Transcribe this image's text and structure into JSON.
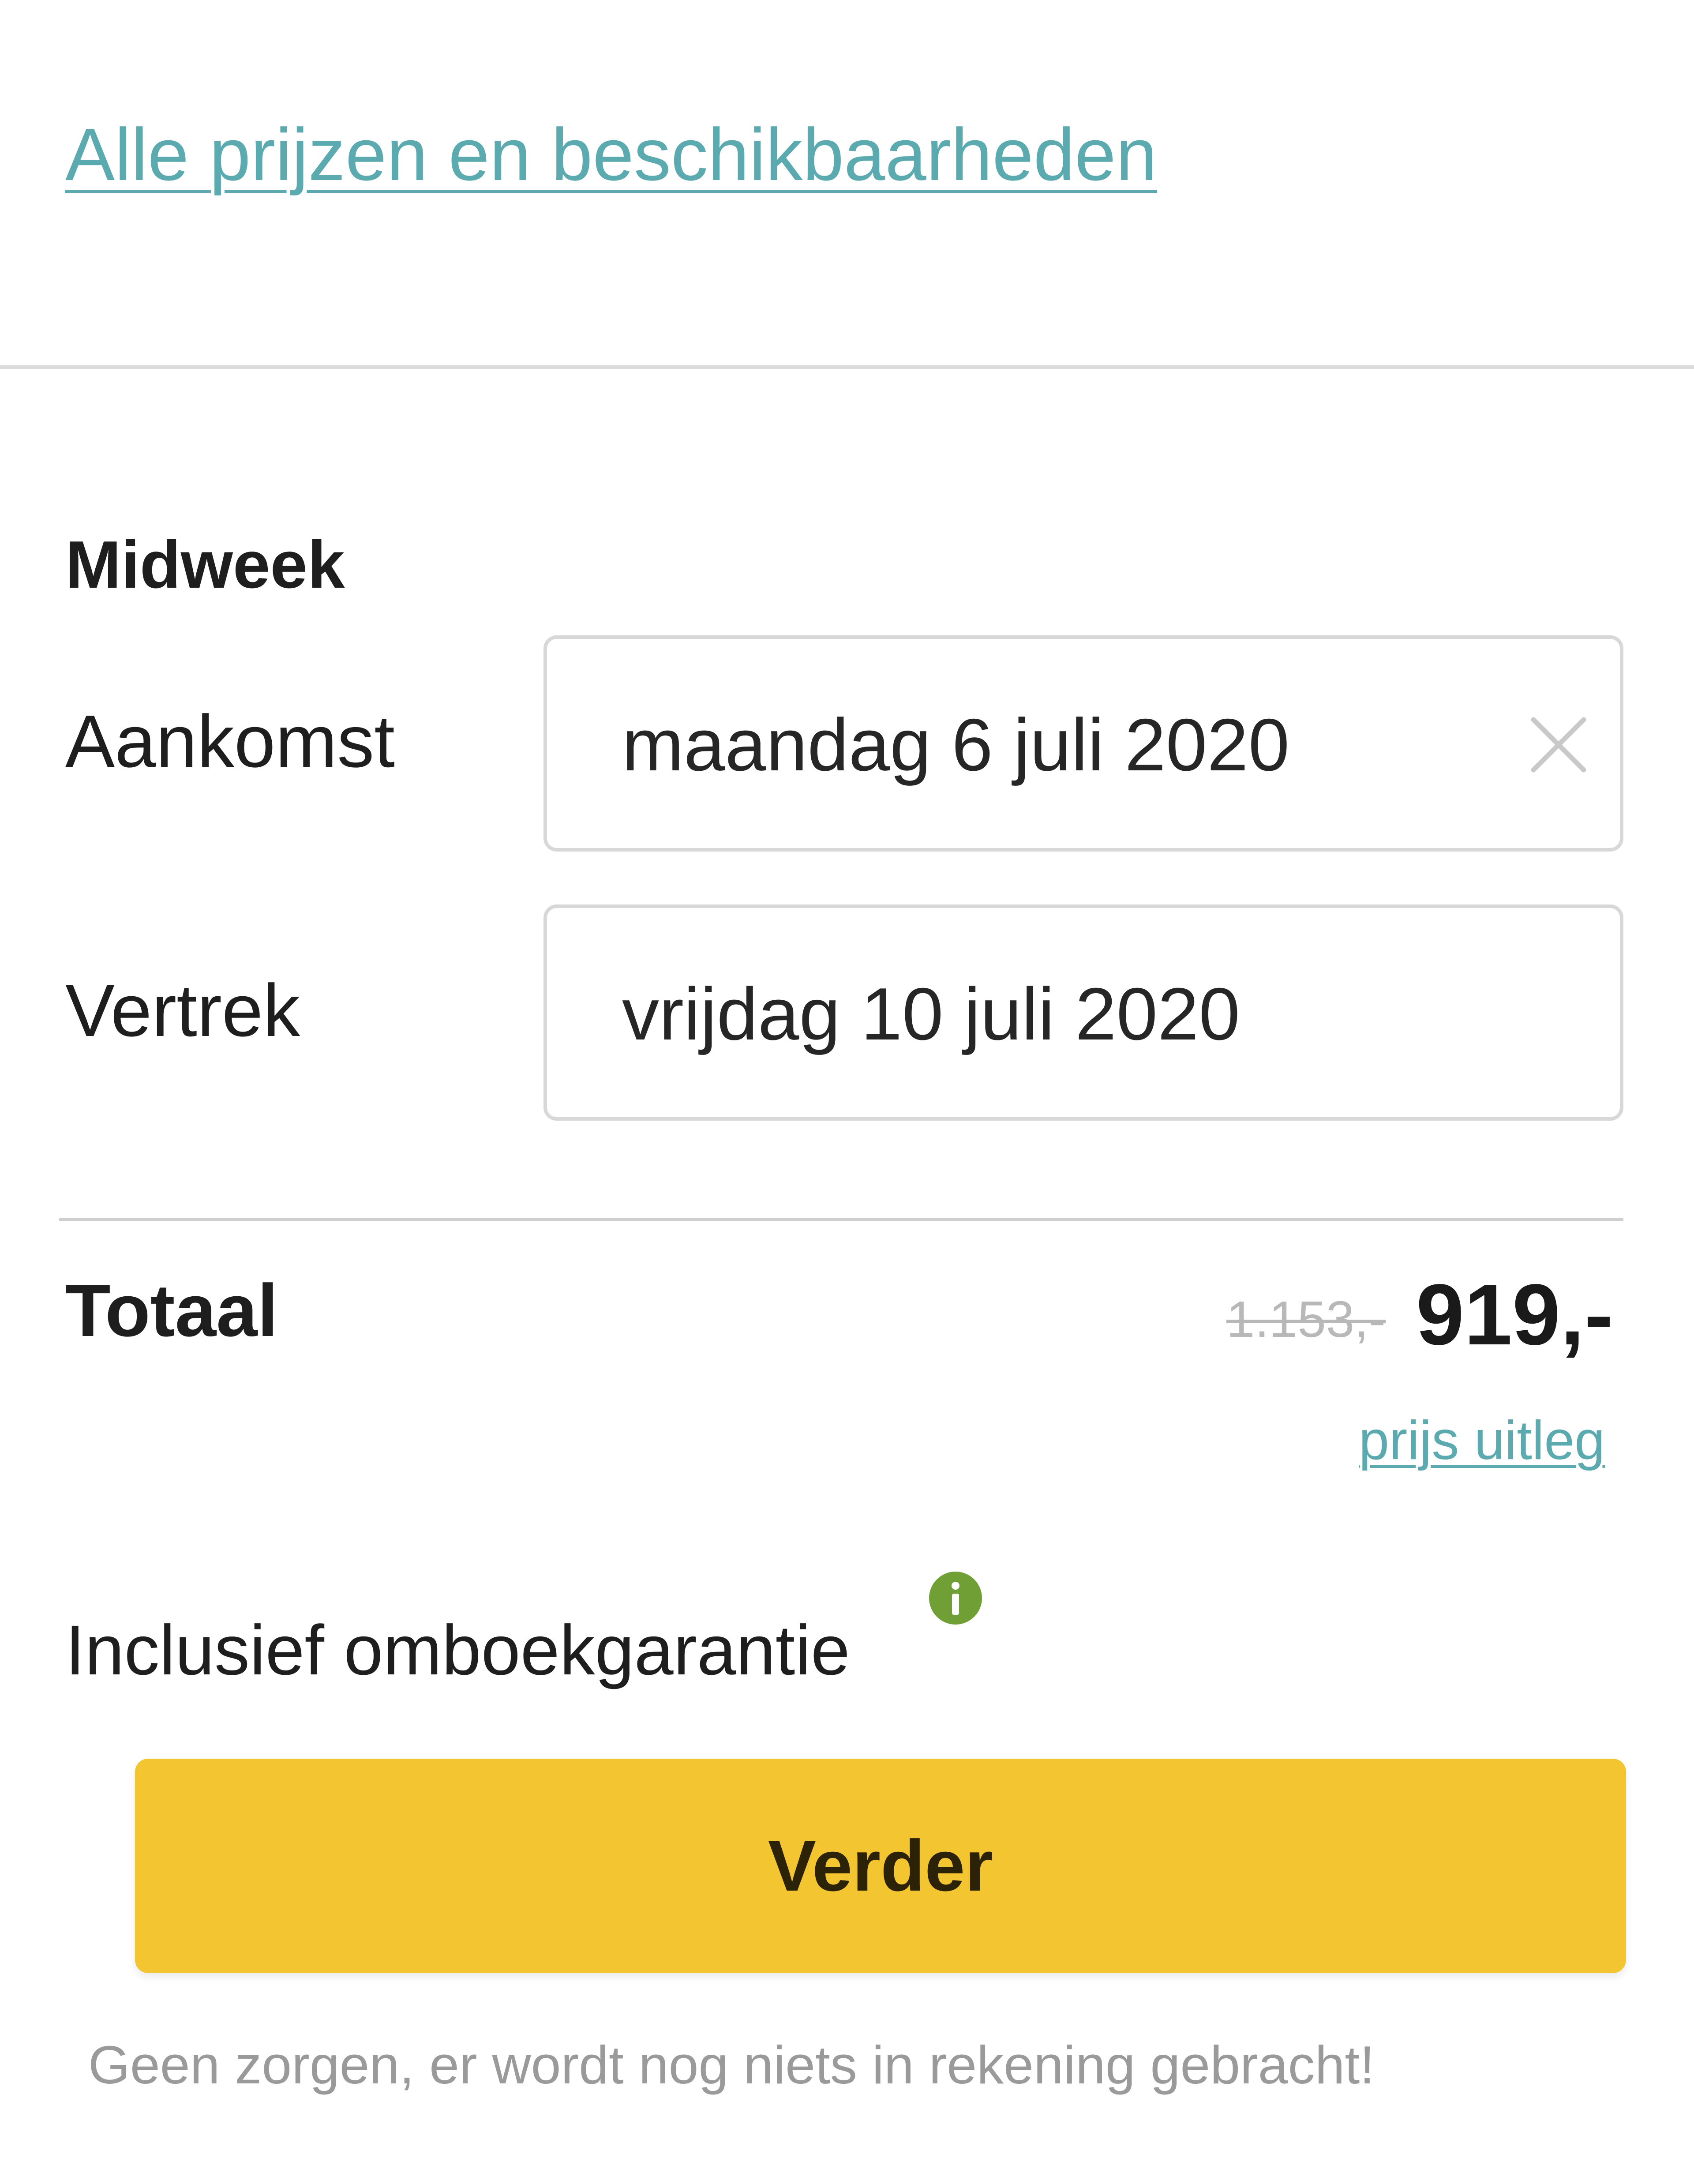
{
  "links": {
    "all_prices": "Alle prijzen en beschikbaarheden",
    "price_explanation": "prijs uitleg"
  },
  "booking": {
    "period": "Midweek",
    "arrival": {
      "label": "Aankomst",
      "value": "maandag 6 juli 2020"
    },
    "departure": {
      "label": "Vertrek",
      "value": "vrijdag 10 juli 2020"
    }
  },
  "total": {
    "label": "Totaal",
    "old_price": "1.153,-",
    "price": "919,-"
  },
  "rebooking": {
    "label": "Inclusief omboekgarantie"
  },
  "actions": {
    "continue": "Verder"
  },
  "note": "Geen zorgen, er wordt nog niets in rekening gebracht!",
  "colors": {
    "link": "#5aaab0",
    "button": "#f2c531",
    "info_icon": "#6f9f35",
    "old_price": "#b8b8b8"
  },
  "icons": {
    "clear": "close-icon",
    "info": "info-icon"
  }
}
